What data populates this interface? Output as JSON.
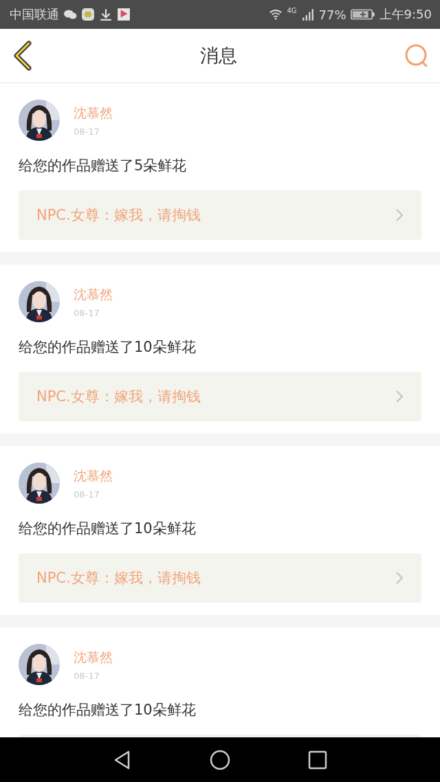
{
  "status_bar": {
    "carrier": "中国联通",
    "network": "4G",
    "battery": "77%",
    "time": "上午9:50"
  },
  "header": {
    "title": "消息"
  },
  "messages": [
    {
      "name": "沈慕然",
      "date": "08-17",
      "text": "给您的作品赠送了5朵鲜花",
      "quote": "NPC.女尊：嫁我，请掏钱"
    },
    {
      "name": "沈慕然",
      "date": "08-17",
      "text": "给您的作品赠送了10朵鲜花",
      "quote": "NPC.女尊：嫁我，请掏钱"
    },
    {
      "name": "沈慕然",
      "date": "08-17",
      "text": "给您的作品赠送了10朵鲜花",
      "quote": "NPC.女尊：嫁我，请掏钱"
    },
    {
      "name": "沈慕然",
      "date": "08-17",
      "text": "给您的作品赠送了10朵鲜花"
    }
  ]
}
